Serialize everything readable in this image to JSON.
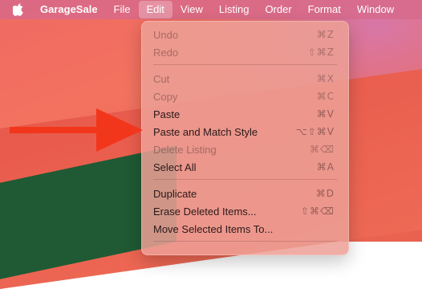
{
  "menubar": {
    "app_name": "GarageSale",
    "items": [
      "File",
      "Edit",
      "View",
      "Listing",
      "Order",
      "Format",
      "Window"
    ]
  },
  "edit_menu": {
    "items": [
      {
        "label": "Undo",
        "shortcut": "⌘Z",
        "enabled": false
      },
      {
        "label": "Redo",
        "shortcut": "⇧⌘Z",
        "enabled": false
      },
      {
        "label": "Cut",
        "shortcut": "⌘X",
        "enabled": false
      },
      {
        "label": "Copy",
        "shortcut": "⌘C",
        "enabled": false
      },
      {
        "label": "Paste",
        "shortcut": "⌘V",
        "enabled": true
      },
      {
        "label": "Paste and Match Style",
        "shortcut": "⌥⇧⌘V",
        "enabled": true
      },
      {
        "label": "Delete Listing",
        "shortcut": "⌘⌫",
        "enabled": false
      },
      {
        "label": "Select All",
        "shortcut": "⌘A",
        "enabled": true
      },
      {
        "label": "Duplicate",
        "shortcut": "⌘D",
        "enabled": true
      },
      {
        "label": "Erase Deleted Items...",
        "shortcut": "⇧⌘⌫",
        "enabled": true
      },
      {
        "label": "Move Selected Items To...",
        "shortcut": "",
        "enabled": true
      }
    ]
  },
  "colors": {
    "arrow": "#f2361c",
    "menubar": "#d6698c",
    "menu_bg": "#eca096"
  }
}
